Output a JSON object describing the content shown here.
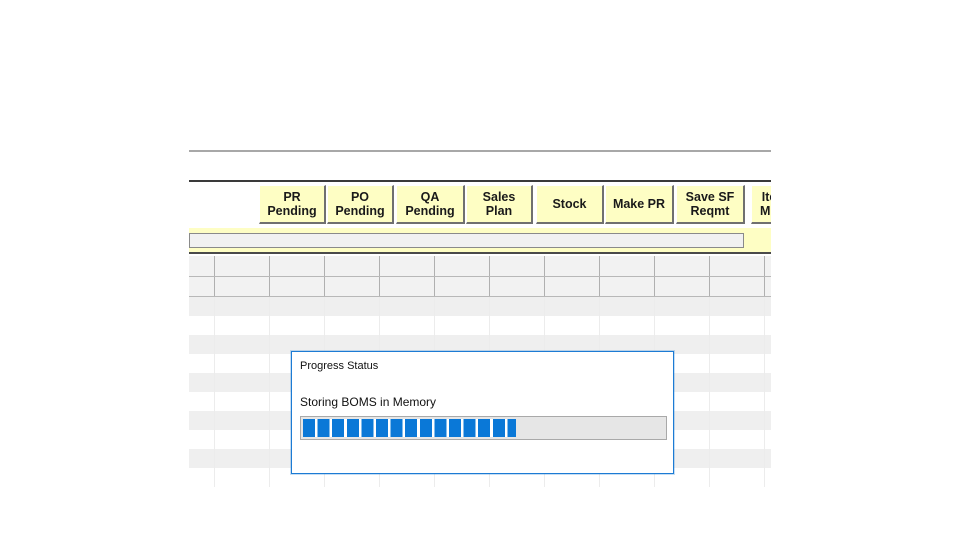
{
  "toolbar": {
    "buttons": [
      {
        "label": "PR\nPending"
      },
      {
        "label": "PO\nPending"
      },
      {
        "label": "QA\nPending"
      },
      {
        "label": "Sales\nPlan"
      },
      {
        "label": "Stock"
      },
      {
        "label": "Make PR"
      },
      {
        "label": "Save SF\nReqmt"
      },
      {
        "label": "Ite\nMu"
      }
    ]
  },
  "dialog": {
    "title": "Progress Status",
    "message": "Storing BOMS in Memory",
    "progress_segments": 15,
    "progress_fraction": 0.59
  },
  "colors": {
    "button_bg": "#fefec4",
    "progress_blue": "#0a78d7",
    "dialog_border": "#1c7bd4"
  }
}
